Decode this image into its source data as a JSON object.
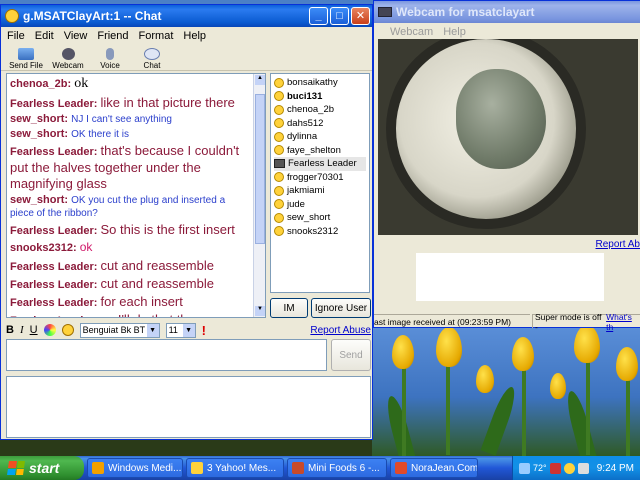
{
  "chat_window": {
    "title": "g.MSATClayArt:1 -- Chat",
    "menu": [
      "File",
      "Edit",
      "View",
      "Friend",
      "Format",
      "Help"
    ],
    "toolbar": [
      {
        "label": "Send File",
        "icon": "send-file-icon"
      },
      {
        "label": "Webcam",
        "icon": "webcam-icon"
      },
      {
        "label": "Voice",
        "icon": "microphone-icon"
      },
      {
        "label": "Chat",
        "icon": "chat-bubbles-icon"
      }
    ],
    "messages": [
      {
        "name": "chenoa_2b:",
        "text": "ok",
        "style": "serif"
      },
      {
        "name": "Fearless Leader:",
        "text": "like in that picture there",
        "style": "big"
      },
      {
        "name": "sew_short:",
        "text": "NJ I can't see anything",
        "style": "blue"
      },
      {
        "name": "sew_short:",
        "text": "OK there it is",
        "style": "blue"
      },
      {
        "name": "Fearless Leader:",
        "text": "that's because I couldn't put the halves together under the magnifying glass",
        "style": "big"
      },
      {
        "name": "sew_short:",
        "text": "OK you cut the plug and inserted a piece of the ribbon?",
        "style": "blue"
      },
      {
        "name": "Fearless Leader:",
        "text": "So this is the first insert",
        "style": "big"
      },
      {
        "name": "snooks2312:",
        "text": "ok",
        "style": "pink"
      },
      {
        "name": "Fearless Leader:",
        "text": "cut and reassemble",
        "style": "big"
      },
      {
        "name": "Fearless Leader:",
        "text": "cut and reassemble",
        "style": "big"
      },
      {
        "name": "Fearless Leader:",
        "text": "for each insert",
        "style": "big"
      },
      {
        "name": "Fearless Leader:",
        "text": "so I'll do that then",
        "style": "big"
      }
    ],
    "users": [
      {
        "name": "bonsaikathy",
        "bold": false,
        "cam": false,
        "selected": false
      },
      {
        "name": "buci131",
        "bold": true,
        "cam": false,
        "selected": false
      },
      {
        "name": "chenoa_2b",
        "bold": false,
        "cam": false,
        "selected": false
      },
      {
        "name": "dahs512",
        "bold": false,
        "cam": false,
        "selected": false
      },
      {
        "name": "dylinna",
        "bold": false,
        "cam": false,
        "selected": false
      },
      {
        "name": "faye_shelton",
        "bold": false,
        "cam": false,
        "selected": false
      },
      {
        "name": "Fearless Leader",
        "bold": false,
        "cam": true,
        "selected": true
      },
      {
        "name": "frogger70301",
        "bold": false,
        "cam": false,
        "selected": false
      },
      {
        "name": "jakmiami",
        "bold": false,
        "cam": false,
        "selected": false
      },
      {
        "name": "jude",
        "bold": false,
        "cam": false,
        "selected": false
      },
      {
        "name": "sew_short",
        "bold": false,
        "cam": false,
        "selected": false
      },
      {
        "name": "snooks2312",
        "bold": false,
        "cam": false,
        "selected": false
      }
    ],
    "im_label": "IM",
    "ignore_label": "Ignore User",
    "format": {
      "bold": "B",
      "italic": "I",
      "underline": "U",
      "font": "Benguiat Bk BT",
      "size": "11"
    },
    "report_abuse": "Report Abuse",
    "send_label": "Send"
  },
  "webcam_window": {
    "title": "Webcam for msatclayart",
    "menu": [
      "Webcam",
      "Help"
    ],
    "report_abuse": "Report Ab",
    "last_image": "ast image received at (09:23:59 PM)",
    "super_mode": "Super mode is off - ",
    "whats_this": "What's th"
  },
  "taskbar": {
    "start": "start",
    "tasks": [
      {
        "label": "Windows Medi...",
        "icon": "media-player-icon",
        "color": "#f3a000"
      },
      {
        "label": "3 Yahoo! Mes...",
        "icon": "yahoo-messenger-icon",
        "color": "#ffd23b"
      },
      {
        "label": "Mini Foods 6 -...",
        "icon": "photo-app-icon",
        "color": "#c84a2a"
      },
      {
        "label": "NoraJean.Com:...",
        "icon": "browser-icon",
        "color": "#e04a2a"
      }
    ],
    "clock": "9:24 PM",
    "tray_text": "72°"
  }
}
